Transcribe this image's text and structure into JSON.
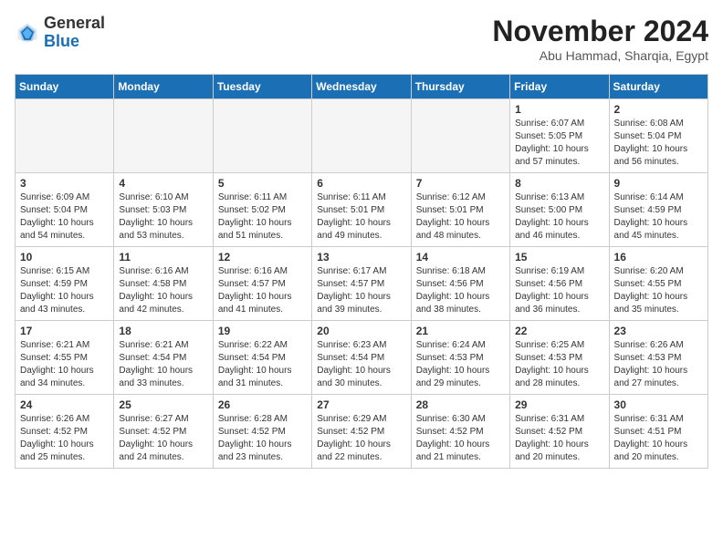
{
  "header": {
    "logo_general": "General",
    "logo_blue": "Blue",
    "month": "November 2024",
    "location": "Abu Hammad, Sharqia, Egypt"
  },
  "weekdays": [
    "Sunday",
    "Monday",
    "Tuesday",
    "Wednesday",
    "Thursday",
    "Friday",
    "Saturday"
  ],
  "weeks": [
    [
      {
        "day": "",
        "info": ""
      },
      {
        "day": "",
        "info": ""
      },
      {
        "day": "",
        "info": ""
      },
      {
        "day": "",
        "info": ""
      },
      {
        "day": "",
        "info": ""
      },
      {
        "day": "1",
        "info": "Sunrise: 6:07 AM\nSunset: 5:05 PM\nDaylight: 10 hours\nand 57 minutes."
      },
      {
        "day": "2",
        "info": "Sunrise: 6:08 AM\nSunset: 5:04 PM\nDaylight: 10 hours\nand 56 minutes."
      }
    ],
    [
      {
        "day": "3",
        "info": "Sunrise: 6:09 AM\nSunset: 5:04 PM\nDaylight: 10 hours\nand 54 minutes."
      },
      {
        "day": "4",
        "info": "Sunrise: 6:10 AM\nSunset: 5:03 PM\nDaylight: 10 hours\nand 53 minutes."
      },
      {
        "day": "5",
        "info": "Sunrise: 6:11 AM\nSunset: 5:02 PM\nDaylight: 10 hours\nand 51 minutes."
      },
      {
        "day": "6",
        "info": "Sunrise: 6:11 AM\nSunset: 5:01 PM\nDaylight: 10 hours\nand 49 minutes."
      },
      {
        "day": "7",
        "info": "Sunrise: 6:12 AM\nSunset: 5:01 PM\nDaylight: 10 hours\nand 48 minutes."
      },
      {
        "day": "8",
        "info": "Sunrise: 6:13 AM\nSunset: 5:00 PM\nDaylight: 10 hours\nand 46 minutes."
      },
      {
        "day": "9",
        "info": "Sunrise: 6:14 AM\nSunset: 4:59 PM\nDaylight: 10 hours\nand 45 minutes."
      }
    ],
    [
      {
        "day": "10",
        "info": "Sunrise: 6:15 AM\nSunset: 4:59 PM\nDaylight: 10 hours\nand 43 minutes."
      },
      {
        "day": "11",
        "info": "Sunrise: 6:16 AM\nSunset: 4:58 PM\nDaylight: 10 hours\nand 42 minutes."
      },
      {
        "day": "12",
        "info": "Sunrise: 6:16 AM\nSunset: 4:57 PM\nDaylight: 10 hours\nand 41 minutes."
      },
      {
        "day": "13",
        "info": "Sunrise: 6:17 AM\nSunset: 4:57 PM\nDaylight: 10 hours\nand 39 minutes."
      },
      {
        "day": "14",
        "info": "Sunrise: 6:18 AM\nSunset: 4:56 PM\nDaylight: 10 hours\nand 38 minutes."
      },
      {
        "day": "15",
        "info": "Sunrise: 6:19 AM\nSunset: 4:56 PM\nDaylight: 10 hours\nand 36 minutes."
      },
      {
        "day": "16",
        "info": "Sunrise: 6:20 AM\nSunset: 4:55 PM\nDaylight: 10 hours\nand 35 minutes."
      }
    ],
    [
      {
        "day": "17",
        "info": "Sunrise: 6:21 AM\nSunset: 4:55 PM\nDaylight: 10 hours\nand 34 minutes."
      },
      {
        "day": "18",
        "info": "Sunrise: 6:21 AM\nSunset: 4:54 PM\nDaylight: 10 hours\nand 33 minutes."
      },
      {
        "day": "19",
        "info": "Sunrise: 6:22 AM\nSunset: 4:54 PM\nDaylight: 10 hours\nand 31 minutes."
      },
      {
        "day": "20",
        "info": "Sunrise: 6:23 AM\nSunset: 4:54 PM\nDaylight: 10 hours\nand 30 minutes."
      },
      {
        "day": "21",
        "info": "Sunrise: 6:24 AM\nSunset: 4:53 PM\nDaylight: 10 hours\nand 29 minutes."
      },
      {
        "day": "22",
        "info": "Sunrise: 6:25 AM\nSunset: 4:53 PM\nDaylight: 10 hours\nand 28 minutes."
      },
      {
        "day": "23",
        "info": "Sunrise: 6:26 AM\nSunset: 4:53 PM\nDaylight: 10 hours\nand 27 minutes."
      }
    ],
    [
      {
        "day": "24",
        "info": "Sunrise: 6:26 AM\nSunset: 4:52 PM\nDaylight: 10 hours\nand 25 minutes."
      },
      {
        "day": "25",
        "info": "Sunrise: 6:27 AM\nSunset: 4:52 PM\nDaylight: 10 hours\nand 24 minutes."
      },
      {
        "day": "26",
        "info": "Sunrise: 6:28 AM\nSunset: 4:52 PM\nDaylight: 10 hours\nand 23 minutes."
      },
      {
        "day": "27",
        "info": "Sunrise: 6:29 AM\nSunset: 4:52 PM\nDaylight: 10 hours\nand 22 minutes."
      },
      {
        "day": "28",
        "info": "Sunrise: 6:30 AM\nSunset: 4:52 PM\nDaylight: 10 hours\nand 21 minutes."
      },
      {
        "day": "29",
        "info": "Sunrise: 6:31 AM\nSunset: 4:52 PM\nDaylight: 10 hours\nand 20 minutes."
      },
      {
        "day": "30",
        "info": "Sunrise: 6:31 AM\nSunset: 4:51 PM\nDaylight: 10 hours\nand 20 minutes."
      }
    ]
  ]
}
